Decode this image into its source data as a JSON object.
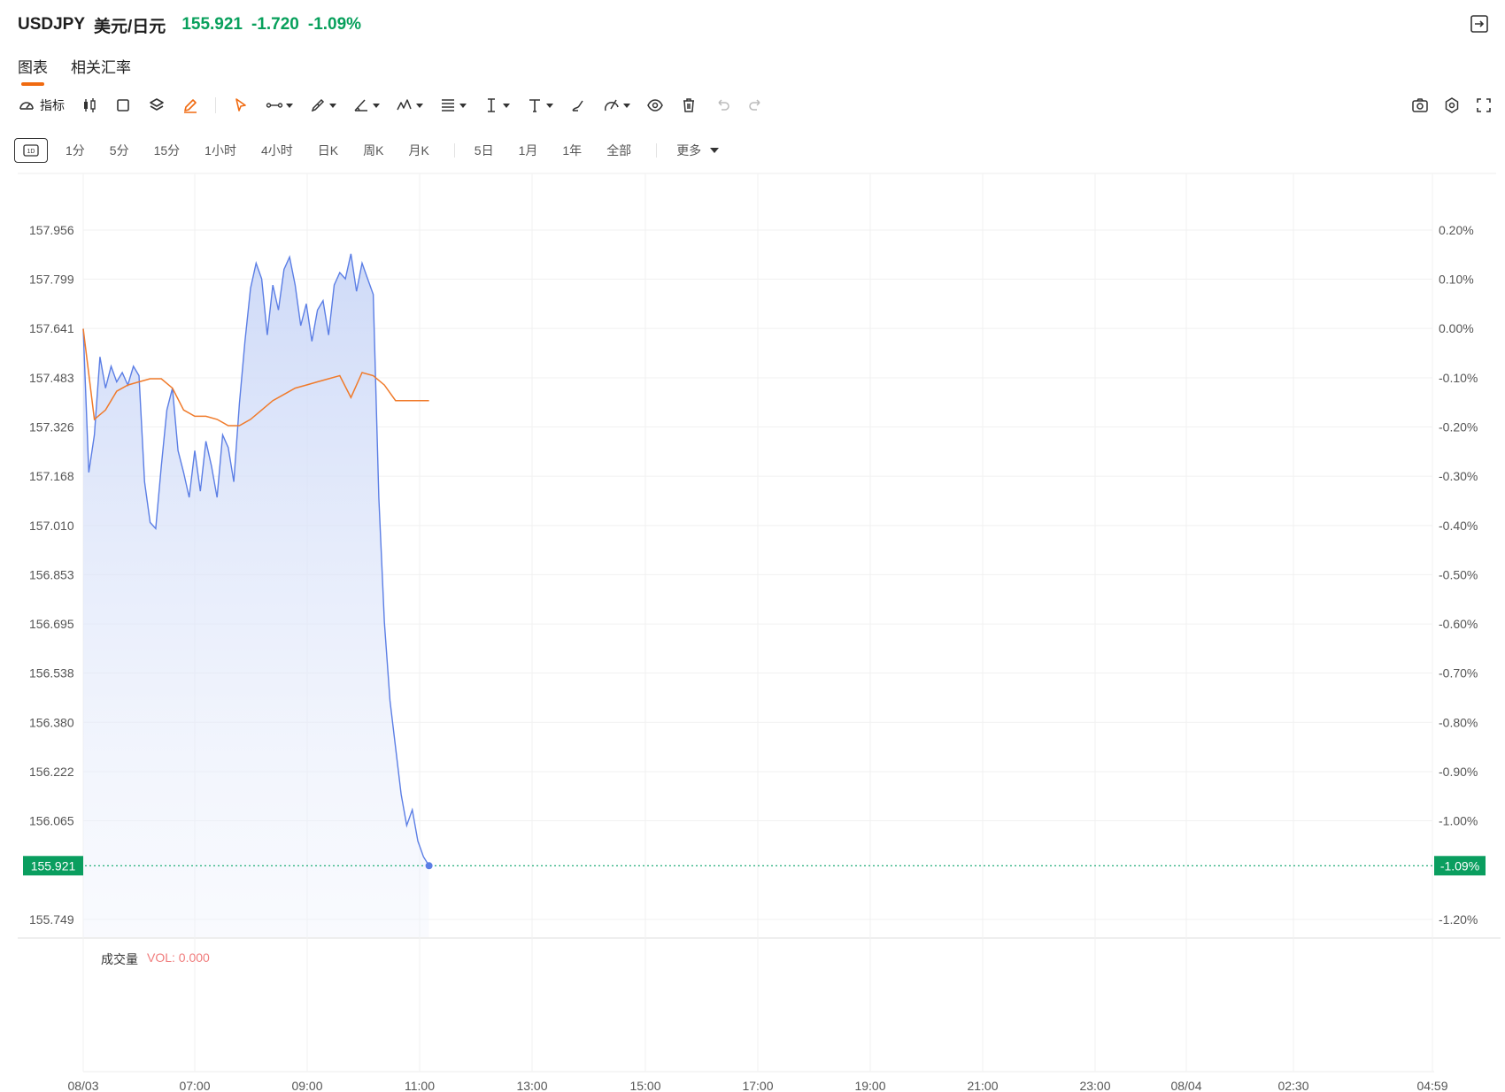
{
  "header": {
    "symbol": "USDJPY",
    "pair_name": "美元/日元",
    "price": "155.921",
    "change": "-1.720",
    "change_pct": "-1.09%"
  },
  "tabs": [
    {
      "label": "图表",
      "active": true
    },
    {
      "label": "相关汇率",
      "active": false
    }
  ],
  "toolbar": {
    "indicator_label": "指标",
    "tools": [
      "candlestick-icon",
      "square-icon",
      "layers-icon",
      "pencil-icon",
      "cursor-icon",
      "line-tool-icon",
      "pen-tool-icon",
      "angle-tool-icon",
      "wave-tool-icon",
      "fib-tool-icon",
      "measure-tool-icon",
      "text-tool-icon",
      "brush-tool-icon",
      "shape-tool-icon",
      "eye-icon",
      "trash-icon",
      "undo-icon",
      "redo-icon"
    ],
    "right_tools": [
      "camera-icon",
      "settings-icon",
      "fullscreen-icon"
    ]
  },
  "periods": {
    "selected_icon": "1D",
    "items": [
      "1分",
      "5分",
      "15分",
      "1小时",
      "4小时",
      "日K",
      "周K",
      "月K",
      "5日",
      "1月",
      "1年",
      "全部"
    ],
    "more_label": "更多"
  },
  "volume": {
    "title": "成交量",
    "value": "VOL: 0.000"
  },
  "colors": {
    "up_green": "#08a05c",
    "price_line": "#5b7ee5",
    "avg_line": "#f07a2a",
    "accent_orange": "#f06a10"
  },
  "chart_data": {
    "type": "area",
    "y_ticks": [
      "157.956",
      "157.799",
      "157.641",
      "157.483",
      "157.326",
      "157.168",
      "157.010",
      "156.853",
      "156.695",
      "156.538",
      "156.380",
      "156.222",
      "156.065",
      "155.749"
    ],
    "y_pct_ticks": [
      "0.20%",
      "0.10%",
      "0.00%",
      "-0.10%",
      "-0.20%",
      "-0.30%",
      "-0.40%",
      "-0.50%",
      "-0.60%",
      "-0.70%",
      "-0.80%",
      "-0.90%",
      "-1.00%",
      "-1.20%"
    ],
    "x_ticks": [
      "08/03",
      "07:00",
      "09:00",
      "11:00",
      "13:00",
      "15:00",
      "17:00",
      "19:00",
      "21:00",
      "23:00",
      "08/04",
      "02:30",
      "04:59"
    ],
    "ylim": [
      155.749,
      157.956
    ],
    "last_price": "155.921",
    "last_pct": "-1.09%",
    "series": [
      {
        "name": "price",
        "x": [
          0,
          0.05,
          0.1,
          0.15,
          0.2,
          0.25,
          0.3,
          0.35,
          0.4,
          0.45,
          0.5,
          0.55,
          0.6,
          0.65,
          0.7,
          0.75,
          0.8,
          0.85,
          0.9,
          0.95,
          1.0,
          1.05,
          1.1,
          1.15,
          1.2,
          1.25,
          1.3,
          1.35,
          1.4,
          1.45,
          1.5,
          1.55,
          1.6,
          1.65,
          1.7,
          1.75,
          1.8,
          1.85,
          1.9,
          1.95,
          2.0,
          2.05,
          2.1,
          2.15,
          2.2,
          2.25,
          2.3,
          2.35,
          2.4,
          2.45,
          2.5,
          2.55,
          2.6,
          2.65,
          2.7,
          2.75,
          2.8,
          2.85,
          2.9,
          2.95,
          3.0,
          3.05,
          3.1,
          3.15,
          3.2,
          3.25,
          3.3,
          3.35,
          3.4,
          3.45,
          3.5,
          3.55,
          3.6,
          3.62,
          3.64,
          3.66,
          3.68,
          3.7,
          3.72,
          3.74,
          3.76,
          3.78,
          3.8,
          3.82,
          3.84,
          3.85,
          3.86,
          3.87,
          3.88,
          3.9
        ],
        "values": [
          157.64,
          157.18,
          157.3,
          157.55,
          157.45,
          157.52,
          157.47,
          157.5,
          157.46,
          157.52,
          157.49,
          157.15,
          157.02,
          157.0,
          157.2,
          157.38,
          157.45,
          157.25,
          157.18,
          157.1,
          157.25,
          157.12,
          157.28,
          157.2,
          157.1,
          157.3,
          157.26,
          157.15,
          157.4,
          157.6,
          157.77,
          157.85,
          157.8,
          157.62,
          157.78,
          157.7,
          157.83,
          157.87,
          157.78,
          157.65,
          157.72,
          157.6,
          157.7,
          157.73,
          157.62,
          157.78,
          157.82,
          157.8,
          157.88,
          157.76,
          157.85,
          157.8,
          157.75,
          157.1,
          156.7,
          156.45,
          156.3,
          156.15,
          156.05,
          156.1,
          156.0,
          155.95,
          155.921,
          155.921,
          155.921,
          155.921,
          155.921,
          155.921,
          155.921,
          155.921,
          155.921,
          155.921,
          155.921,
          155.921,
          155.921,
          155.921,
          155.921,
          155.921,
          155.921,
          155.921,
          155.921,
          155.921,
          155.921,
          155.921,
          155.921,
          155.921,
          155.921,
          155.921,
          155.921,
          155.921
        ]
      },
      {
        "name": "average",
        "x": [
          0,
          0.1,
          0.2,
          0.3,
          0.4,
          0.5,
          0.6,
          0.7,
          0.8,
          0.9,
          1.0,
          1.1,
          1.2,
          1.3,
          1.4,
          1.5,
          1.6,
          1.7,
          1.8,
          1.9,
          2.0,
          2.1,
          2.2,
          2.3,
          2.4,
          2.5,
          2.6,
          2.7,
          2.8,
          2.9,
          3.0,
          3.1
        ],
        "values": [
          157.64,
          157.35,
          157.38,
          157.44,
          157.46,
          157.47,
          157.48,
          157.48,
          157.45,
          157.38,
          157.36,
          157.36,
          157.35,
          157.33,
          157.33,
          157.35,
          157.38,
          157.41,
          157.43,
          157.45,
          157.46,
          157.47,
          157.48,
          157.49,
          157.42,
          157.5,
          157.49,
          157.46,
          157.41,
          157.41,
          157.41,
          157.41
        ]
      }
    ]
  }
}
